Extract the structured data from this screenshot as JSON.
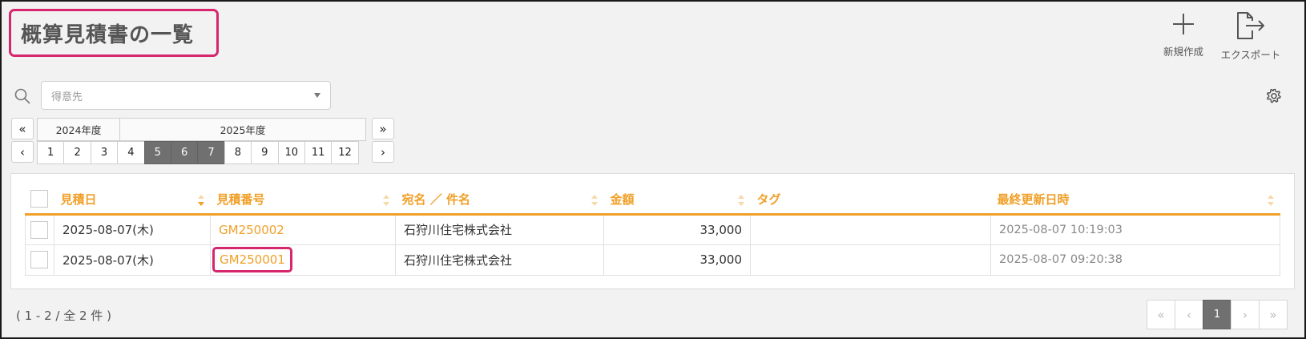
{
  "page": {
    "title": "概算見積書の一覧"
  },
  "actions": {
    "new_label": "新規作成",
    "export_label": "エクスポート"
  },
  "search": {
    "placeholder": "得意先"
  },
  "period": {
    "prev_year": "«",
    "next_year": "»",
    "prev": "‹",
    "next": "›",
    "years": [
      {
        "label": "2024年度"
      },
      {
        "label": "2025年度"
      }
    ],
    "months": [
      "1",
      "2",
      "3",
      "4",
      "5",
      "6",
      "7",
      "8",
      "9",
      "10",
      "11",
      "12"
    ],
    "active_months": [
      "5",
      "6",
      "7"
    ]
  },
  "table": {
    "columns": [
      "見積日",
      "見積番号",
      "宛名 ／ 件名",
      "金額",
      "タグ",
      "最終更新日時"
    ],
    "rows": [
      {
        "date": "2025-08-07(木)",
        "number": "GM250002",
        "recipient": "石狩川住宅株式会社",
        "amount": "33,000",
        "tag": "",
        "updated": "2025-08-07 10:19:03"
      },
      {
        "date": "2025-08-07(木)",
        "number": "GM250001",
        "recipient": "石狩川住宅株式会社",
        "amount": "33,000",
        "tag": "",
        "updated": "2025-08-07 09:20:38"
      }
    ]
  },
  "footer": {
    "count_text": "( 1 - 2 / 全 2 件 )",
    "pager": {
      "first": "«",
      "prev": "‹",
      "current": "1",
      "next": "›",
      "last": "»"
    }
  },
  "colors": {
    "accent": "#f0a028",
    "highlight": "#d6266e",
    "active": "#707070"
  }
}
